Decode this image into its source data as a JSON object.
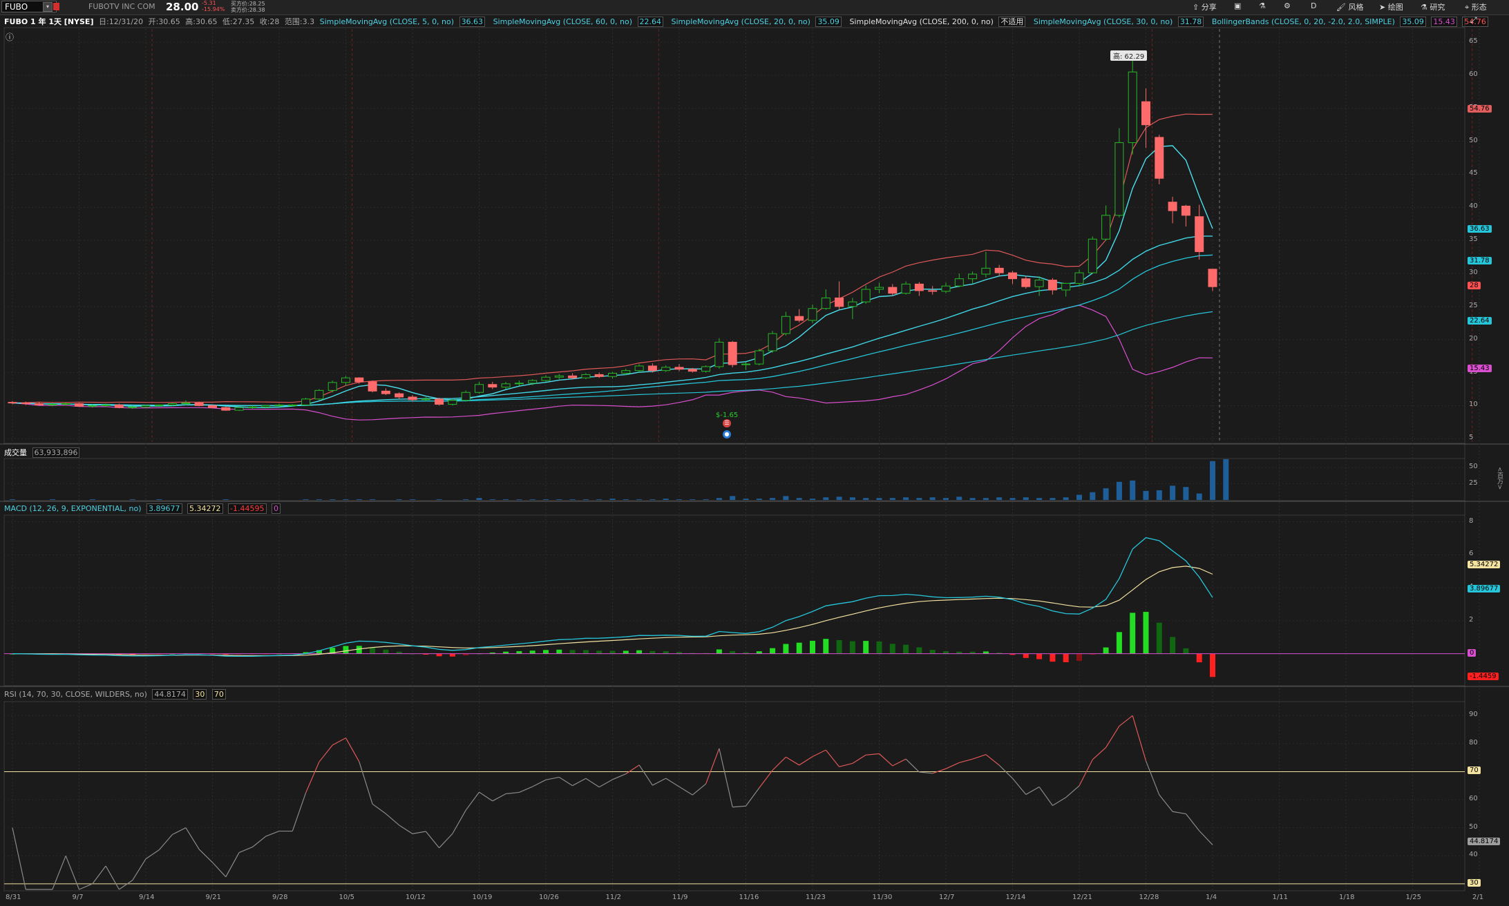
{
  "toolbar": {
    "symbol": "FUBO",
    "company": "FUBOTV INC COM",
    "last": "28.00",
    "change": "-5.31",
    "change_pct": "-15.94%",
    "bid": "买方价:28.25",
    "ask": "卖方价:28.38",
    "tools": [
      "分享",
      "风格",
      "绘图",
      "研究",
      "形态"
    ],
    "aggregation": "D"
  },
  "header": {
    "title": "FUBO 1 年 1天 [NYSE]",
    "date": "日:12/31/20",
    "open": "开:30.65",
    "high": "高:30.65",
    "low": "低:27.35",
    "close": "收:28",
    "range": "范围:3.3",
    "studies": [
      {
        "name": "SimpleMovingAvg (CLOSE, 5, 0, no)",
        "value": "36.63",
        "color": "#4dd0e1"
      },
      {
        "name": "SimpleMovingAvg (CLOSE, 60, 0, no)",
        "value": "22.64",
        "color": "#4dd0e1"
      },
      {
        "name": "SimpleMovingAvg (CLOSE, 20, 0, no)",
        "value": "35.09",
        "color": "#4dd0e1"
      },
      {
        "name": "SimpleMovingAvg (CLOSE, 200, 0, no)",
        "value": "不适用",
        "color": "#e0e0e0"
      },
      {
        "name": "SimpleMovingAvg (CLOSE, 30, 0, no)",
        "value": "31.78",
        "color": "#4dd0e1"
      },
      {
        "name": "BollingerBands (CLOSE, 0, 20, -2.0, 2.0, SIMPLE)",
        "value": "35.09",
        "value2": "15.43",
        "value3": "54.76",
        "color": "#4dd0e1"
      }
    ]
  },
  "price_panel": {
    "high_callout": "高: 62.29",
    "signal_text": "$-1.65",
    "axis": [
      "65",
      "60",
      "55",
      "50",
      "45",
      "40",
      "35",
      "30",
      "25",
      "20",
      "15",
      "10",
      "5"
    ],
    "tags": [
      {
        "label": "54.76",
        "color": "#e25d5d"
      },
      {
        "label": "36.63",
        "color": "#26c6da"
      },
      {
        "label": "31.78",
        "color": "#26c6da"
      },
      {
        "label": "28",
        "color": "#ff5252"
      },
      {
        "label": "22.64",
        "color": "#26c6da"
      },
      {
        "label": "15.43",
        "color": "#d94fd0"
      }
    ]
  },
  "volume_panel": {
    "label": "成交量",
    "value": "63,933,896",
    "axis": [
      "50",
      "25"
    ],
    "unit": "<百万>"
  },
  "macd_panel": {
    "label": "MACD (12, 26, 9, EXPONENTIAL, no)",
    "v1": "3.89677",
    "v2": "5.34272",
    "v3": "-1.44595",
    "v4": "0",
    "axis": [
      "8",
      "6",
      "4",
      "2",
      "0"
    ],
    "tags": [
      {
        "label": "5.34272",
        "color": "#f4e2a0"
      },
      {
        "label": "3.89677",
        "color": "#26c6da"
      },
      {
        "label": "0",
        "color": "#d94fd0"
      },
      {
        "label": "-1.4459",
        "color": "#ff2020"
      }
    ]
  },
  "rsi_panel": {
    "label": "RSI (14, 70, 30, CLOSE, WILDERS, no)",
    "v1": "44.8174",
    "v2": "30",
    "v3": "70",
    "axis": [
      "90",
      "80",
      "70",
      "60",
      "50",
      "40",
      "30"
    ],
    "tags": [
      {
        "label": "70",
        "color": "#f4e2a0"
      },
      {
        "label": "44.8174",
        "color": "#9e9e9e"
      },
      {
        "label": "30",
        "color": "#f4e2a0"
      }
    ]
  },
  "x_axis": [
    "8/31",
    "9/7",
    "9/14",
    "9/21",
    "9/28",
    "10/5",
    "10/12",
    "10/19",
    "10/26",
    "11/2",
    "11/9",
    "11/16",
    "11/23",
    "11/30",
    "12/7",
    "12/14",
    "12/21",
    "12/28",
    "1/4",
    "1/11",
    "1/18",
    "1/25",
    "2/1"
  ],
  "chart_data": {
    "type": "candlestick",
    "start": "2020-08-31",
    "candles": [
      [
        10.5,
        10.7,
        10.2,
        10.4
      ],
      [
        10.4,
        10.6,
        10.1,
        10.3
      ],
      [
        10.3,
        10.5,
        10.0,
        10.1
      ],
      [
        10.1,
        10.4,
        9.9,
        10.2
      ],
      [
        10.2,
        10.5,
        10.0,
        10.3
      ],
      [
        10.3,
        10.4,
        9.8,
        9.9
      ],
      [
        9.9,
        10.2,
        9.7,
        10.0
      ],
      [
        10.0,
        10.3,
        9.8,
        10.1
      ],
      [
        10.1,
        10.3,
        9.6,
        9.7
      ],
      [
        9.7,
        10.0,
        9.5,
        9.8
      ],
      [
        9.8,
        10.1,
        9.6,
        10.0
      ],
      [
        10.0,
        10.2,
        9.8,
        10.1
      ],
      [
        10.1,
        10.4,
        9.9,
        10.3
      ],
      [
        10.3,
        10.8,
        10.1,
        10.4
      ],
      [
        10.4,
        10.6,
        9.9,
        10.0
      ],
      [
        10.0,
        10.2,
        9.6,
        9.7
      ],
      [
        9.7,
        9.9,
        9.2,
        9.3
      ],
      [
        9.3,
        9.8,
        9.2,
        9.7
      ],
      [
        9.7,
        10.0,
        9.5,
        9.8
      ],
      [
        9.8,
        10.1,
        9.6,
        10.0
      ],
      [
        10.0,
        10.3,
        9.8,
        10.1
      ],
      [
        10.1,
        10.2,
        9.9,
        10.1
      ],
      [
        10.1,
        11.2,
        10.0,
        11.0
      ],
      [
        11.0,
        12.5,
        10.8,
        12.3
      ],
      [
        12.3,
        13.8,
        12.0,
        13.5
      ],
      [
        13.5,
        14.5,
        13.0,
        14.2
      ],
      [
        14.2,
        14.3,
        13.3,
        13.6
      ],
      [
        13.6,
        13.8,
        12.0,
        12.2
      ],
      [
        12.2,
        12.6,
        11.6,
        11.8
      ],
      [
        11.8,
        12.0,
        11.0,
        11.3
      ],
      [
        11.3,
        11.6,
        10.6,
        10.9
      ],
      [
        10.9,
        11.3,
        10.7,
        11.0
      ],
      [
        11.0,
        11.2,
        10.0,
        10.2
      ],
      [
        10.2,
        11.0,
        10.0,
        10.8
      ],
      [
        10.8,
        12.3,
        10.6,
        12.0
      ],
      [
        12.0,
        13.6,
        11.8,
        13.2
      ],
      [
        13.2,
        13.6,
        12.5,
        12.8
      ],
      [
        12.8,
        13.6,
        12.5,
        13.3
      ],
      [
        13.3,
        13.8,
        13.0,
        13.4
      ],
      [
        13.4,
        14.0,
        13.1,
        13.8
      ],
      [
        13.8,
        14.6,
        13.6,
        14.3
      ],
      [
        14.3,
        14.8,
        14.0,
        14.5
      ],
      [
        14.5,
        14.9,
        14.0,
        14.2
      ],
      [
        14.2,
        14.9,
        14.0,
        14.7
      ],
      [
        14.7,
        15.0,
        14.2,
        14.4
      ],
      [
        14.4,
        15.1,
        14.1,
        14.9
      ],
      [
        14.9,
        15.6,
        14.6,
        15.3
      ],
      [
        15.3,
        16.3,
        15.0,
        16.0
      ],
      [
        16.0,
        16.4,
        15.0,
        15.3
      ],
      [
        15.3,
        16.1,
        15.1,
        15.8
      ],
      [
        15.8,
        16.3,
        15.2,
        15.5
      ],
      [
        15.5,
        15.7,
        15.0,
        15.2
      ],
      [
        15.2,
        16.1,
        15.0,
        15.9
      ],
      [
        15.9,
        20.2,
        15.6,
        19.6
      ],
      [
        19.6,
        19.8,
        15.8,
        16.2
      ],
      [
        16.2,
        16.6,
        15.4,
        16.3
      ],
      [
        16.3,
        18.6,
        16.1,
        18.3
      ],
      [
        18.3,
        21.3,
        18.0,
        20.9
      ],
      [
        20.9,
        24.2,
        20.6,
        23.5
      ],
      [
        23.5,
        24.6,
        22.6,
        22.9
      ],
      [
        22.9,
        25.3,
        22.5,
        24.7
      ],
      [
        24.7,
        27.6,
        24.5,
        26.3
      ],
      [
        26.3,
        28.8,
        24.5,
        25.0
      ],
      [
        25.0,
        26.3,
        23.1,
        25.7
      ],
      [
        25.7,
        28.2,
        25.4,
        27.6
      ],
      [
        27.6,
        28.6,
        27.0,
        27.9
      ],
      [
        27.9,
        28.4,
        26.6,
        27.0
      ],
      [
        27.0,
        28.8,
        26.8,
        28.4
      ],
      [
        28.4,
        28.7,
        26.6,
        27.4
      ],
      [
        27.4,
        28.1,
        26.8,
        27.3
      ],
      [
        27.3,
        28.6,
        27.0,
        28.1
      ],
      [
        28.1,
        30.0,
        27.9,
        29.2
      ],
      [
        29.2,
        30.3,
        28.5,
        29.9
      ],
      [
        29.9,
        33.3,
        29.4,
        30.8
      ],
      [
        30.8,
        31.3,
        29.6,
        30.1
      ],
      [
        30.1,
        30.4,
        28.4,
        29.2
      ],
      [
        29.2,
        29.6,
        27.7,
        28.0
      ],
      [
        28.0,
        29.6,
        26.6,
        29.0
      ],
      [
        29.0,
        29.3,
        26.8,
        27.5
      ],
      [
        27.5,
        28.6,
        26.5,
        28.5
      ],
      [
        28.5,
        30.6,
        28.0,
        30.1
      ],
      [
        30.1,
        35.6,
        30.0,
        35.2
      ],
      [
        35.2,
        40.3,
        35.0,
        38.8
      ],
      [
        38.8,
        52.0,
        38.5,
        49.8
      ],
      [
        49.8,
        62.29,
        48.0,
        60.5
      ],
      [
        56.0,
        58.0,
        49.0,
        52.5
      ],
      [
        50.6,
        51.0,
        43.5,
        44.4
      ],
      [
        40.8,
        41.6,
        37.6,
        39.5
      ],
      [
        40.2,
        40.4,
        37.1,
        38.8
      ],
      [
        38.6,
        40.4,
        32.1,
        33.3
      ],
      [
        30.65,
        30.65,
        27.35,
        28.0
      ]
    ],
    "volume": [
      1,
      0,
      0,
      1,
      0,
      0,
      1,
      0,
      0,
      1,
      0,
      1,
      0,
      0,
      0,
      0,
      1,
      0,
      0,
      0,
      0,
      0,
      1,
      1,
      1,
      1,
      1,
      1,
      0,
      1,
      1,
      0,
      1,
      0,
      1,
      3,
      1,
      1,
      1,
      1,
      1,
      1,
      1,
      1,
      1,
      2,
      1,
      1,
      1,
      2,
      1,
      1,
      1,
      3,
      6,
      2,
      2,
      3,
      6,
      3,
      2,
      4,
      5,
      4,
      3,
      3,
      3,
      4,
      3,
      4,
      3,
      5,
      3,
      3,
      4,
      3,
      4,
      3,
      3,
      4,
      8,
      12,
      18,
      28,
      30,
      14,
      15,
      22,
      20,
      10,
      60,
      63
    ],
    "sma5_end": 36.63,
    "sma20_end": 35.09,
    "sma30_end": 31.78,
    "sma60_end": 22.64,
    "bb_upper_end": 54.76,
    "bb_lower_end": 15.43,
    "macd_end": 3.89677,
    "signal_end": 5.34272,
    "hist_end": -1.44595,
    "rsi_end": 44.8174,
    "rsi_overbought": 70,
    "rsi_oversold": 30
  }
}
